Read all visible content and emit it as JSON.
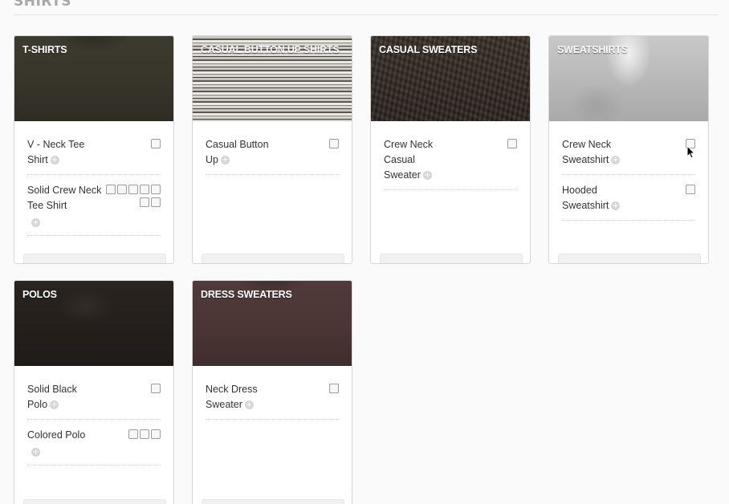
{
  "section": {
    "title": "SHIRTS"
  },
  "categories": [
    {
      "title": "T-SHIRTS",
      "items": [
        {
          "name": "V - Neck Tee Shirt",
          "checkboxes": 1
        },
        {
          "name": "Solid Crew Neck Tee Shirt",
          "checkboxes": 6
        }
      ]
    },
    {
      "title": "CASUAL BUTTON UP SHIRTS",
      "items": [
        {
          "name": "Casual Button Up",
          "checkboxes": 1
        }
      ]
    },
    {
      "title": "CASUAL SWEATERS",
      "items": [
        {
          "name": "Crew Neck Casual Sweater",
          "checkboxes": 1
        }
      ]
    },
    {
      "title": "SWEATSHIRTS",
      "items": [
        {
          "name": "Crew Neck Sweatshirt",
          "checkboxes": 1
        },
        {
          "name": "Hooded Sweatshirt",
          "checkboxes": 1
        }
      ]
    },
    {
      "title": "POLOS",
      "items": [
        {
          "name": "Solid Black Polo",
          "checkboxes": 1
        },
        {
          "name": "Colored Polo",
          "checkboxes": 3
        }
      ]
    },
    {
      "title": "DRESS SWEATERS",
      "items": [
        {
          "name": "Neck Dress Sweater",
          "checkboxes": 1
        }
      ]
    }
  ],
  "icons": {
    "add": "plus-circle-icon",
    "cursor": "mouse-pointer-icon"
  },
  "colors": {
    "section_title": "#a9a9a9",
    "card_border": "#d6d6d6"
  }
}
